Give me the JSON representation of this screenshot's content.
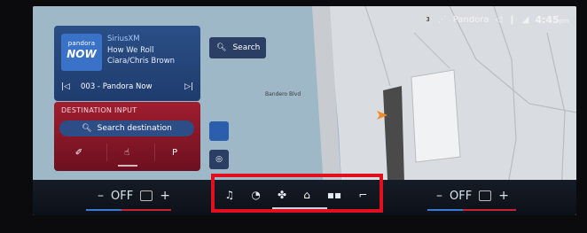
{
  "status": {
    "profile_badge": "3",
    "source": "Pandora",
    "time": "4:45",
    "ampm": "pm"
  },
  "media": {
    "logo_top": "pandora",
    "logo_bottom": "NOW",
    "source": "SiriusXM",
    "song": "How We Roll",
    "artist": "Ciara/Chris Brown",
    "station": "003 - Pandora Now"
  },
  "destination": {
    "title": "DESTINATION INPUT",
    "search_label": "Search destination",
    "parking": "P"
  },
  "map": {
    "search_label": "Search",
    "street_label": "Bandero Blvd"
  },
  "climate": {
    "left": {
      "minus": "–",
      "value": "OFF",
      "plus": "+"
    },
    "right": {
      "minus": "–",
      "value": "OFF",
      "plus": "+"
    }
  },
  "colors": {
    "accent_red": "#c4242f",
    "media_blue": "#2a4f86",
    "highlight_red": "#e0101e"
  },
  "icons": [
    "search-icon",
    "music-icon",
    "navigation-icon",
    "fan-icon",
    "home-icon",
    "apps-icon",
    "phone-icon",
    "location-arrow-icon"
  ]
}
